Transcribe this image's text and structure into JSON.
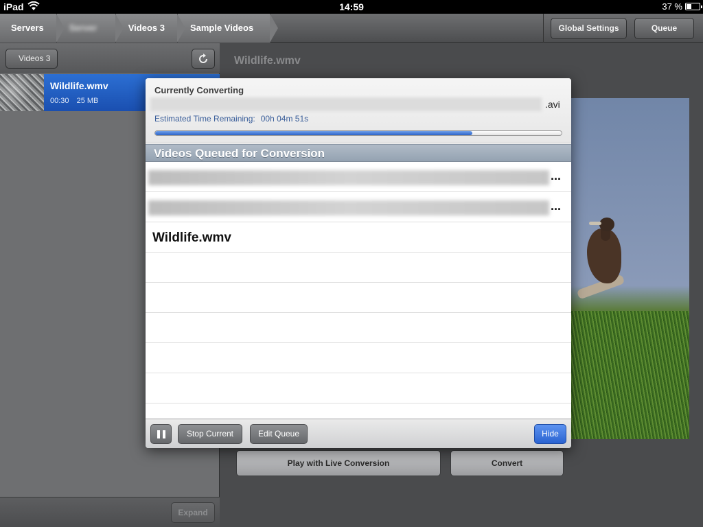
{
  "status_bar": {
    "carrier": "iPad",
    "time": "14:59",
    "battery_percent": "37 %",
    "battery_level": 0.37
  },
  "breadcrumb": {
    "items": [
      {
        "label": "Servers",
        "blurred": false
      },
      {
        "label": "Server",
        "blurred": true
      },
      {
        "label": "Videos 3",
        "blurred": false
      },
      {
        "label": "Sample Videos",
        "blurred": false
      }
    ]
  },
  "toolbar": {
    "global_settings_label": "Global Settings",
    "queue_label": "Queue"
  },
  "left_panel": {
    "back_label": "Videos 3",
    "refresh_icon": "refresh-icon",
    "video": {
      "title": "Wildlife.wmv",
      "duration": "00:30",
      "size": "25 MB"
    },
    "expand_label": "Expand"
  },
  "detail": {
    "title": "Wildlife.wmv",
    "play_live_label": "Play with Live Conversion",
    "convert_label": "Convert"
  },
  "modal": {
    "currently_converting_label": "Currently Converting",
    "current_file_ext": ".avi",
    "eta_label": "Estimated Time Remaining:",
    "eta_value": "00h 04m 51s",
    "progress": 0.78,
    "queue_header": "Videos Queued for Conversion",
    "queue_items": [
      {
        "blurred": true,
        "suffix": "..."
      },
      {
        "blurred": true,
        "suffix": "..."
      },
      {
        "blurred": false,
        "name": "Wildlife.wmv"
      }
    ],
    "empty_rows": 5,
    "footer": {
      "pause_icon": "pause-icon",
      "stop_current_label": "Stop Current",
      "edit_queue_label": "Edit Queue",
      "hide_label": "Hide"
    }
  },
  "colors": {
    "selection_blue": "#1f5cc0",
    "hide_button_blue": "#2a63d1",
    "progress_blue": "#2b63c7"
  }
}
